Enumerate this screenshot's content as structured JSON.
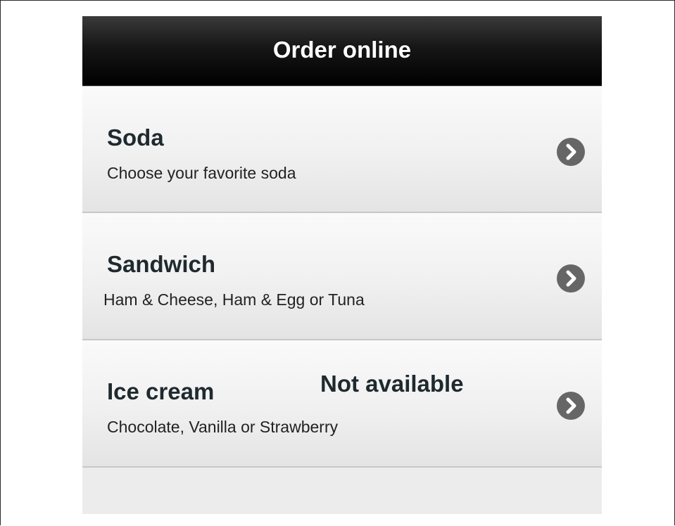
{
  "header": {
    "title": "Order online"
  },
  "items": [
    {
      "title": "Soda",
      "subtitle": "Choose your favorite soda",
      "icon": "chevron-right-icon"
    },
    {
      "title": "Sandwich",
      "subtitle": "Ham & Cheese, Ham & Egg or Tuna",
      "icon": "chevron-right-icon"
    },
    {
      "title": "Ice cream",
      "subtitle": "Chocolate, Vanilla or Strawberry",
      "note": "Not available",
      "icon": "chevron-right-icon"
    }
  ],
  "colors": {
    "header_bg": "#000000",
    "header_text": "#ffffff",
    "chevron_bg": "#666666",
    "title_text": "#1f2a2f"
  }
}
